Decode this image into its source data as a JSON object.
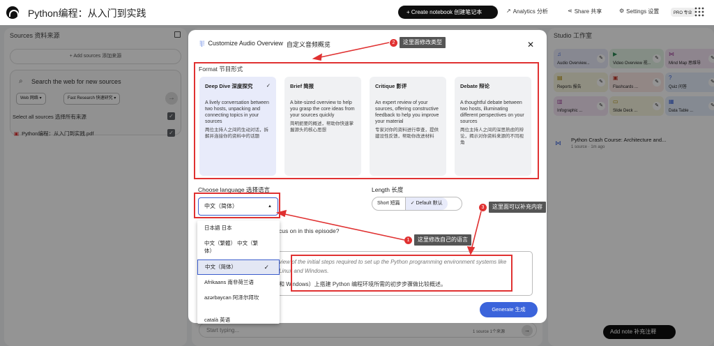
{
  "app": {
    "title": "Python编程：从入门到实践",
    "create_btn": "+ Create notebook 创建笔记本",
    "analytics": "Analytics 分析",
    "share": "Share 共享",
    "settings": "Settings 设置",
    "pro": "PRO 专业"
  },
  "sources": {
    "title": "Sources 资料来源",
    "add": "+ Add sources 添加来源",
    "search_label": "Search the web for new sources",
    "chip_web": "Web 网络 ▾",
    "chip_research": "Fast Research 快速研究 ▾",
    "select_all": "Select all sources 选择所有来源",
    "item": "Python编程：从入门到实践.pdf"
  },
  "studio": {
    "title": "Studio 工作室",
    "tiles": [
      {
        "label": "Audio Overview...",
        "icon": "♫"
      },
      {
        "label": "Video Overview 视...",
        "icon": "▶"
      },
      {
        "label": "Mind Map 思维导",
        "icon": "⋈"
      },
      {
        "label": "Reports 报告",
        "icon": "▤"
      },
      {
        "label": "Flashcards ...",
        "icon": "▣"
      },
      {
        "label": "Quiz 问答",
        "icon": "?"
      },
      {
        "label": "Infographic ...",
        "icon": "▥"
      },
      {
        "label": "Slide Deck ...",
        "icon": "▭"
      },
      {
        "label": "Data Table ...",
        "icon": "▦"
      }
    ],
    "note_title": "Python Crash Course: Architecture and...",
    "note_meta": "1 source · 1m ago"
  },
  "chat": {
    "placeholder": "Start typing...",
    "count": "1 source 1个来源"
  },
  "add_note": "Add note 补充注释",
  "modal": {
    "title": "Customize Audio Overview",
    "title_zh": "自定义音频概览",
    "format_label": "Format 节目形式",
    "cards": [
      {
        "title": "Deep Dive 深度探究",
        "en": "A lively conversation between two hosts, unpacking and connecting topics in your sources",
        "zh": "两位主持人之间的生动对话，拆解并连接你的资料中的话题"
      },
      {
        "title": "Brief 简报",
        "en": "A bite-sized overview to help you grasp the core ideas from your sources quickly",
        "zh": "简明扼要的概述，帮助你快速掌握源头的核心思想"
      },
      {
        "title": "Critique 影评",
        "en": "An expert review of your sources, offering constructive feedback to help you improve your material",
        "zh": "专家对你的资料进行审查，提供建设性反馈，帮助你改进材料"
      },
      {
        "title": "Debate 辩论",
        "en": "A thoughtful debate between two hosts, illuminating different perspectives on your sources",
        "zh": "两位主持人之间的深思熟虑的辩论，揭示对你资料来源的不同视角"
      }
    ],
    "lang_label": "Choose language 选择语言",
    "lang_value": "中文（简体）",
    "length_label": "Length 长度",
    "len_short": "Short 短篇",
    "len_default": "✓ Default 默认",
    "focus_label": "cus on in this episode?",
    "prompt_en": "view of the initial steps required to set up the Python programming environment systems like Linux and Windows.",
    "prompt_zh": "和 Windows）上搭建 Python 编程环境所需的初步步骤做比较概述。",
    "generate": "Generate 生成"
  },
  "dropdown": {
    "items": [
      {
        "label": "日本語   日本"
      },
      {
        "label": "中文（繁體）  中文（繁体）"
      },
      {
        "label": "中文（简体）"
      },
      {
        "label": "Afrikaans 南非荷兰语"
      },
      {
        "label": "azərbaycan 阿泽尔拜坎"
      },
      {
        "label": "català 英语"
      }
    ]
  },
  "callouts": {
    "c1": "这里修改自己的语言",
    "c2": "这里面修改类型",
    "c3": "这里面可以补充内容",
    "n1": "1",
    "n2": "2",
    "n3": "3"
  },
  "colors": {
    "accent": "#3b64db",
    "annotation_red": "#e03131"
  }
}
